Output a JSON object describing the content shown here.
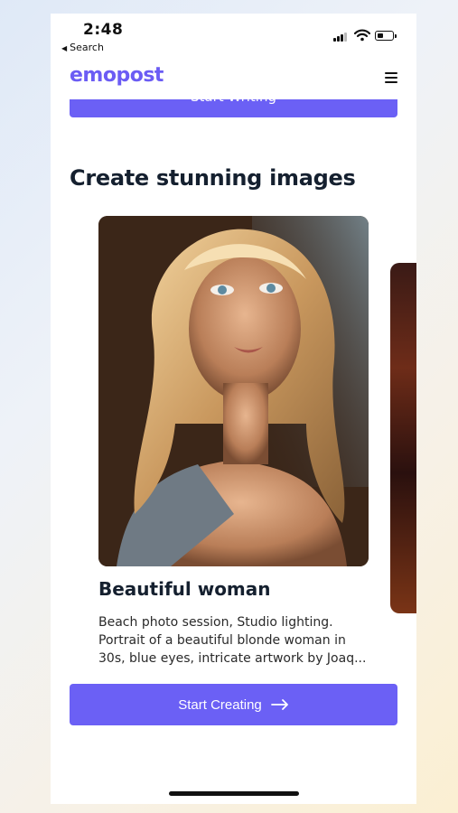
{
  "status_bar": {
    "time": "2:48",
    "back_label": "Search"
  },
  "nav": {
    "logo": "emopost"
  },
  "previous_button": {
    "label": "Start Writing",
    "icon": "arrow-right-icon"
  },
  "section": {
    "title": "Create stunning images"
  },
  "card": {
    "title": "Beautiful woman",
    "description": "Beach photo session, Studio lighting. Portrait of a beautiful blonde woman in 30s, blue eyes, intricate artwork by Joaq..."
  },
  "cta": {
    "label": "Start Creating",
    "icon": "arrow-right-icon"
  },
  "colors": {
    "accent": "#6b60f5",
    "logo": "#6b5cf4",
    "heading": "#15202f"
  }
}
